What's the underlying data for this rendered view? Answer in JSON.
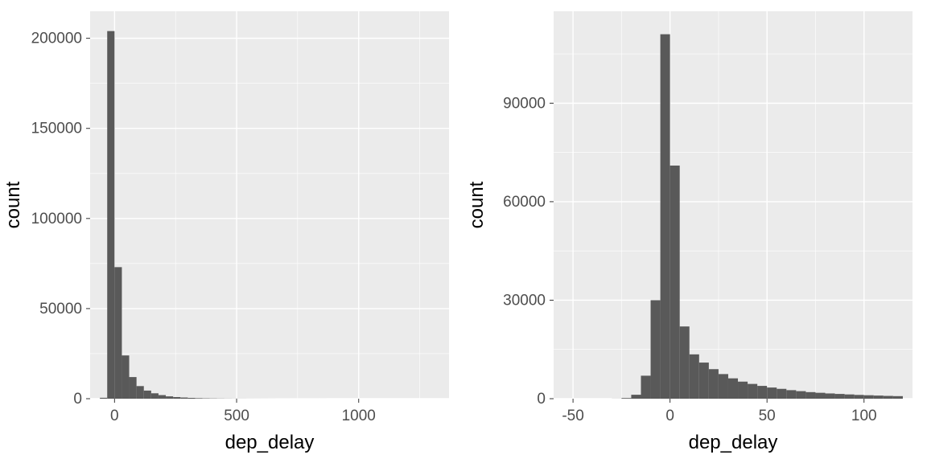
{
  "chart_data": [
    {
      "type": "bar",
      "xlabel": "dep_delay",
      "ylabel": "count",
      "xlim": [
        -100,
        1370
      ],
      "ylim": [
        0,
        215000
      ],
      "x_ticks": [
        0,
        500,
        1000
      ],
      "y_ticks": [
        0,
        50000,
        100000,
        150000,
        200000
      ],
      "bin_width": 30,
      "bins": [
        {
          "x": -45,
          "count": 500
        },
        {
          "x": -15,
          "count": 204000
        },
        {
          "x": 15,
          "count": 73000
        },
        {
          "x": 45,
          "count": 24000
        },
        {
          "x": 75,
          "count": 12000
        },
        {
          "x": 105,
          "count": 7000
        },
        {
          "x": 135,
          "count": 4500
        },
        {
          "x": 165,
          "count": 3000
        },
        {
          "x": 195,
          "count": 2000
        },
        {
          "x": 225,
          "count": 1300
        },
        {
          "x": 255,
          "count": 900
        },
        {
          "x": 285,
          "count": 650
        },
        {
          "x": 315,
          "count": 450
        },
        {
          "x": 345,
          "count": 300
        },
        {
          "x": 375,
          "count": 200
        },
        {
          "x": 405,
          "count": 150
        },
        {
          "x": 435,
          "count": 100
        },
        {
          "x": 465,
          "count": 70
        },
        {
          "x": 495,
          "count": 50
        },
        {
          "x": 525,
          "count": 40
        },
        {
          "x": 555,
          "count": 30
        },
        {
          "x": 585,
          "count": 25
        },
        {
          "x": 615,
          "count": 20
        },
        {
          "x": 645,
          "count": 15
        },
        {
          "x": 675,
          "count": 12
        },
        {
          "x": 705,
          "count": 10
        },
        {
          "x": 735,
          "count": 8
        },
        {
          "x": 765,
          "count": 7
        },
        {
          "x": 795,
          "count": 6
        },
        {
          "x": 825,
          "count": 5
        },
        {
          "x": 855,
          "count": 4
        },
        {
          "x": 885,
          "count": 3
        },
        {
          "x": 915,
          "count": 2
        },
        {
          "x": 1005,
          "count": 1
        },
        {
          "x": 1095,
          "count": 1
        },
        {
          "x": 1305,
          "count": 1
        }
      ]
    },
    {
      "type": "bar",
      "xlabel": "dep_delay",
      "ylabel": "count",
      "xlim": [
        -60,
        125
      ],
      "ylim": [
        0,
        118000
      ],
      "x_ticks": [
        -50,
        0,
        50,
        100
      ],
      "y_ticks": [
        0,
        30000,
        60000,
        90000
      ],
      "bin_width": 5,
      "bins": [
        {
          "x": -27.5,
          "count": 20
        },
        {
          "x": -22.5,
          "count": 200
        },
        {
          "x": -17.5,
          "count": 1200
        },
        {
          "x": -12.5,
          "count": 7000
        },
        {
          "x": -7.5,
          "count": 30000
        },
        {
          "x": -2.5,
          "count": 111000
        },
        {
          "x": 2.5,
          "count": 71000
        },
        {
          "x": 7.5,
          "count": 22000
        },
        {
          "x": 12.5,
          "count": 13500
        },
        {
          "x": 17.5,
          "count": 11000
        },
        {
          "x": 22.5,
          "count": 9000
        },
        {
          "x": 27.5,
          "count": 7500
        },
        {
          "x": 32.5,
          "count": 6200
        },
        {
          "x": 37.5,
          "count": 5200
        },
        {
          "x": 42.5,
          "count": 4500
        },
        {
          "x": 47.5,
          "count": 3900
        },
        {
          "x": 52.5,
          "count": 3400
        },
        {
          "x": 57.5,
          "count": 3000
        },
        {
          "x": 62.5,
          "count": 2600
        },
        {
          "x": 67.5,
          "count": 2300
        },
        {
          "x": 72.5,
          "count": 2000
        },
        {
          "x": 77.5,
          "count": 1800
        },
        {
          "x": 82.5,
          "count": 1600
        },
        {
          "x": 87.5,
          "count": 1450
        },
        {
          "x": 92.5,
          "count": 1300
        },
        {
          "x": 97.5,
          "count": 1150
        },
        {
          "x": 102.5,
          "count": 1050
        },
        {
          "x": 107.5,
          "count": 950
        },
        {
          "x": 112.5,
          "count": 850
        },
        {
          "x": 117.5,
          "count": 780
        }
      ]
    }
  ]
}
